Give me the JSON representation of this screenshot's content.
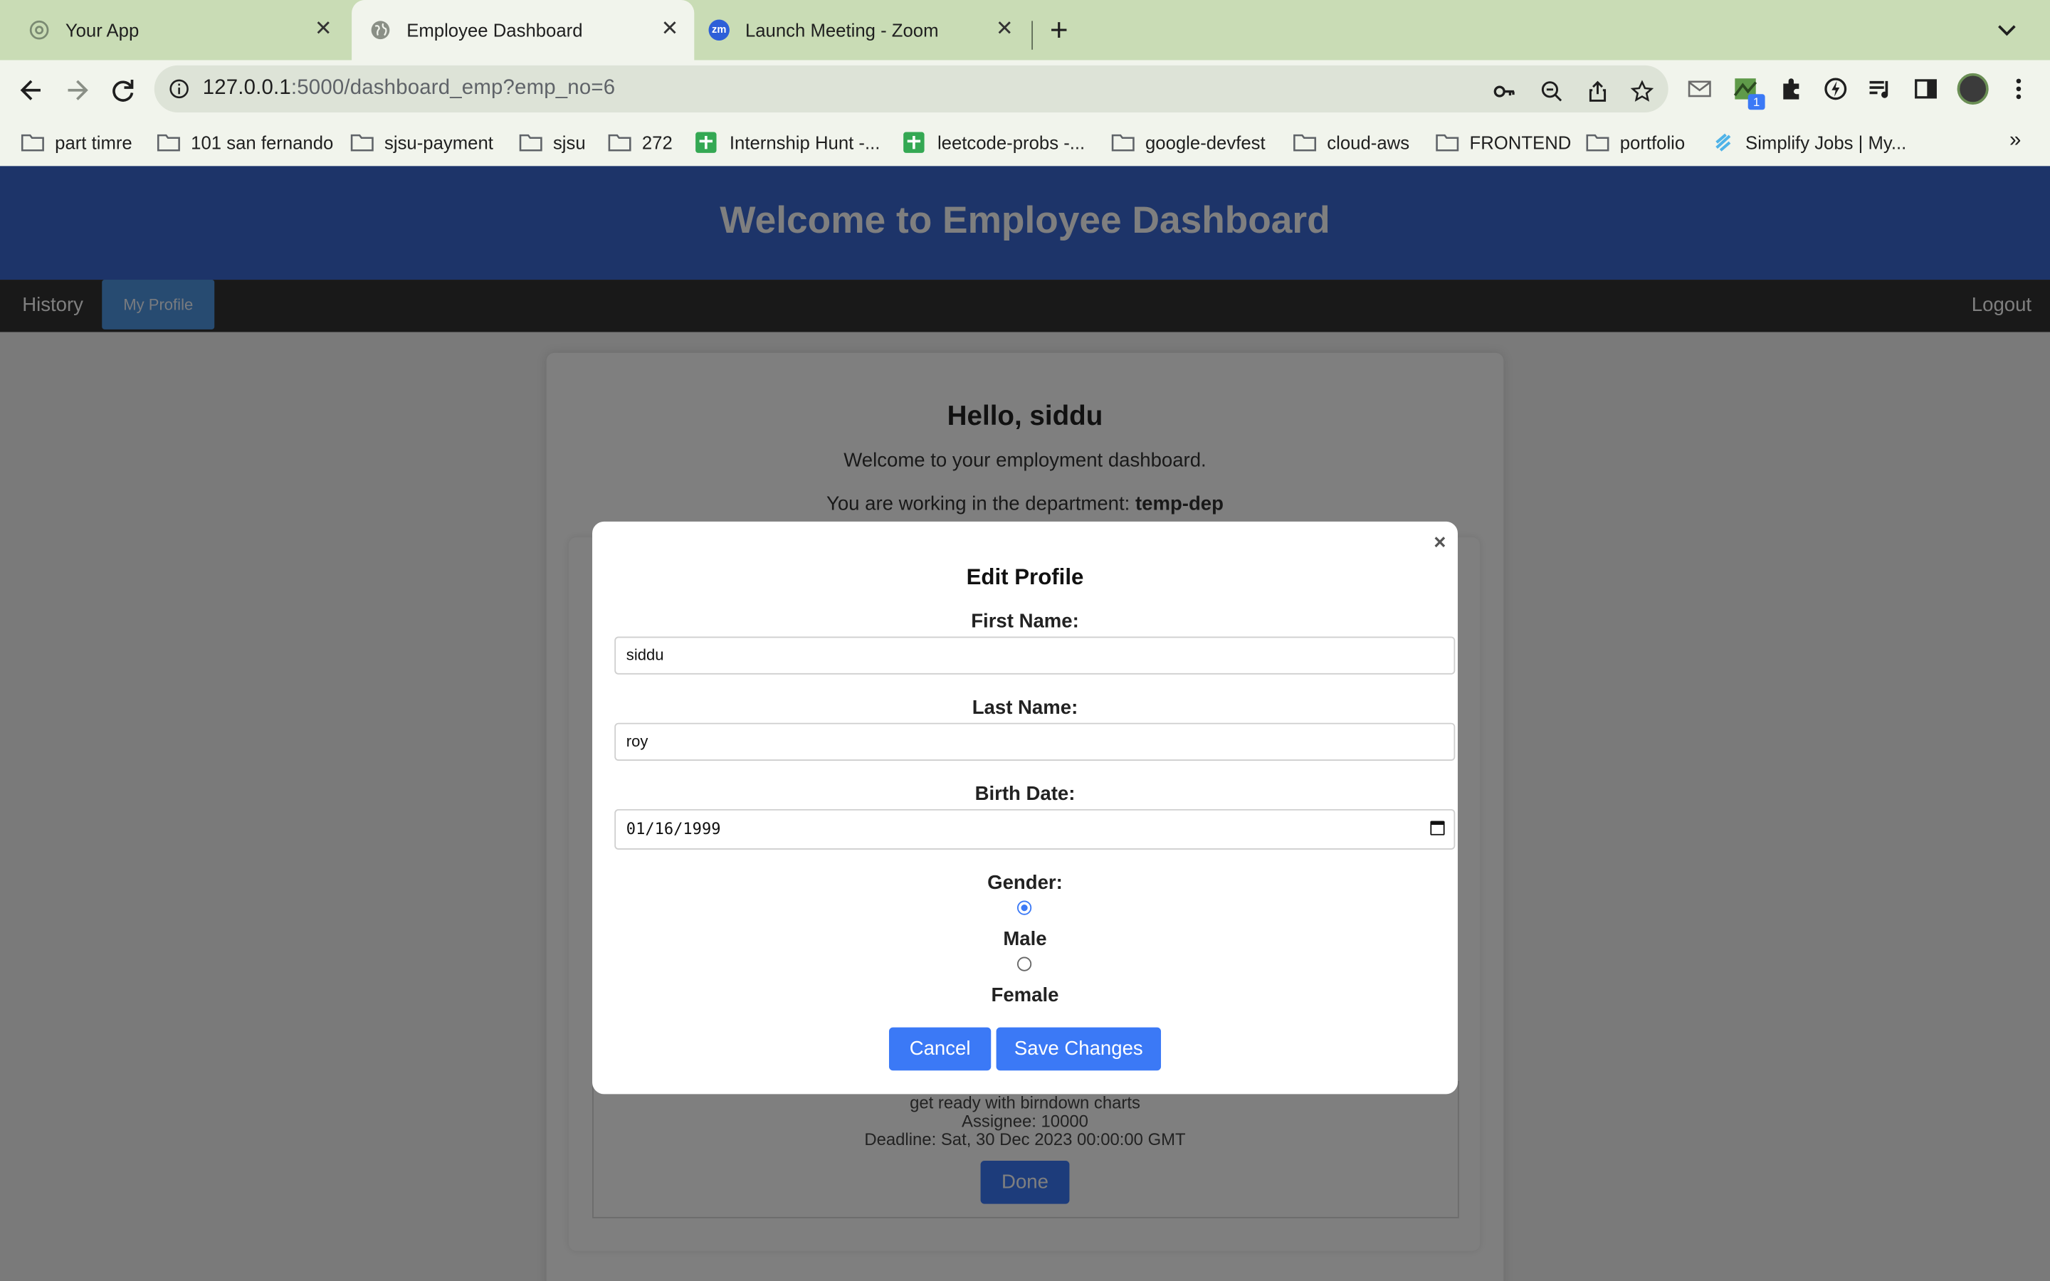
{
  "browser": {
    "tabs": [
      {
        "title": "Your App",
        "active": false
      },
      {
        "title": "Employee Dashboard",
        "active": true
      },
      {
        "title": "Launch Meeting - Zoom",
        "active": false
      }
    ],
    "url_host": "127.0.0.1",
    "url_path": ":5000/dashboard_emp?emp_no=6",
    "bookmarks": [
      {
        "label": "part timre",
        "icon": "folder-icon"
      },
      {
        "label": "101 san fernando",
        "icon": "folder-icon"
      },
      {
        "label": "sjsu-payment",
        "icon": "folder-icon"
      },
      {
        "label": "sjsu",
        "icon": "folder-icon"
      },
      {
        "label": "272",
        "icon": "folder-icon"
      },
      {
        "label": "Internship Hunt -...",
        "icon": "sheets-icon"
      },
      {
        "label": "leetcode-probs -...",
        "icon": "sheets-icon"
      },
      {
        "label": "google-devfest",
        "icon": "folder-icon"
      },
      {
        "label": "cloud-aws",
        "icon": "folder-icon"
      },
      {
        "label": "FRONTEND",
        "icon": "folder-icon"
      },
      {
        "label": "portfolio",
        "icon": "folder-icon"
      },
      {
        "label": "Simplify Jobs | My...",
        "icon": "simplify-icon"
      }
    ],
    "more_bookmarks": "»",
    "extension_badge": "1"
  },
  "page": {
    "banner_title": "Welcome to Employee Dashboard",
    "nav": {
      "history": "History",
      "my_profile": "My Profile",
      "logout": "Logout"
    },
    "greeting": "Hello, siddu",
    "welcome_text": "Welcome to your employment dashboard.",
    "department_prefix": "You are working in the department: ",
    "department": "temp-dep",
    "task": {
      "description": "get ready with birndown charts",
      "assignee": "Assignee: 10000",
      "deadline": "Deadline: Sat, 30 Dec 2023 00:00:00 GMT",
      "done_label": "Done"
    }
  },
  "modal": {
    "close": "×",
    "title": "Edit Profile",
    "first_name_label": "First Name:",
    "first_name_value": "siddu",
    "last_name_label": "Last Name:",
    "last_name_value": "roy",
    "birth_date_label": "Birth Date:",
    "birth_date_value": "01/16/1999",
    "gender_label": "Gender:",
    "gender_options": [
      "Male",
      "Female"
    ],
    "gender_selected": "Male",
    "cancel_label": "Cancel",
    "save_label": "Save Changes"
  },
  "colors": {
    "banner": "#3a69d3",
    "navbar": "#333333",
    "nav_active": "#4f96e3",
    "primary_button": "#3b79f6",
    "tabstrip": "#c9dcb5"
  }
}
